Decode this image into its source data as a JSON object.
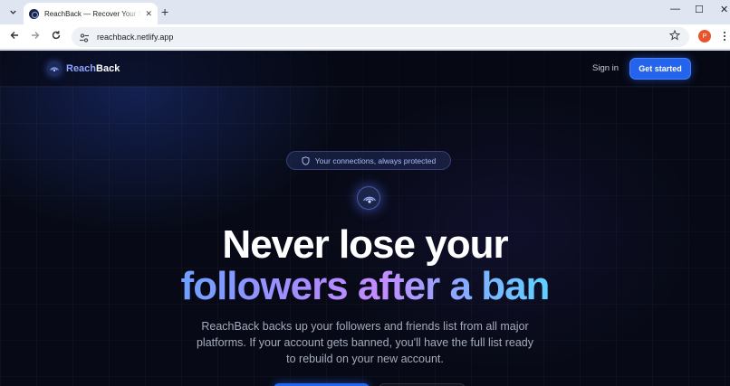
{
  "browser": {
    "tab_title": "ReachBack — Recover Your Social Connections",
    "tab_close": "✕",
    "new_tab": "+",
    "url": "reachback.netlify.app",
    "profile_initial": "P",
    "window_controls": {
      "minimize": "—",
      "maximize": "☐",
      "close": "✕"
    }
  },
  "nav": {
    "brand_part1": "Reach",
    "brand_part2": "Back",
    "sign_in": "Sign in",
    "get_started": "Get started"
  },
  "hero": {
    "badge": "Your connections, always protected",
    "headline_line1": "Never lose your",
    "headline_line2": "followers after a ban",
    "subtitle": "ReachBack backs up your followers and friends list from all major platforms. If your account gets banned, you'll have the full list ready to rebuild on your new account."
  },
  "colors": {
    "accent": "#2463eb",
    "brand_light": "#8fa4ff",
    "background": "#070a16"
  },
  "icons": {
    "tab_search": "chevron-down-icon",
    "back": "arrow-left-icon",
    "forward": "arrow-right-icon",
    "reload": "reload-icon",
    "site_info": "tune-icon",
    "bookmark": "star-icon",
    "menu": "kebab-icon",
    "badge": "shield-icon",
    "logo": "signal-icon"
  }
}
